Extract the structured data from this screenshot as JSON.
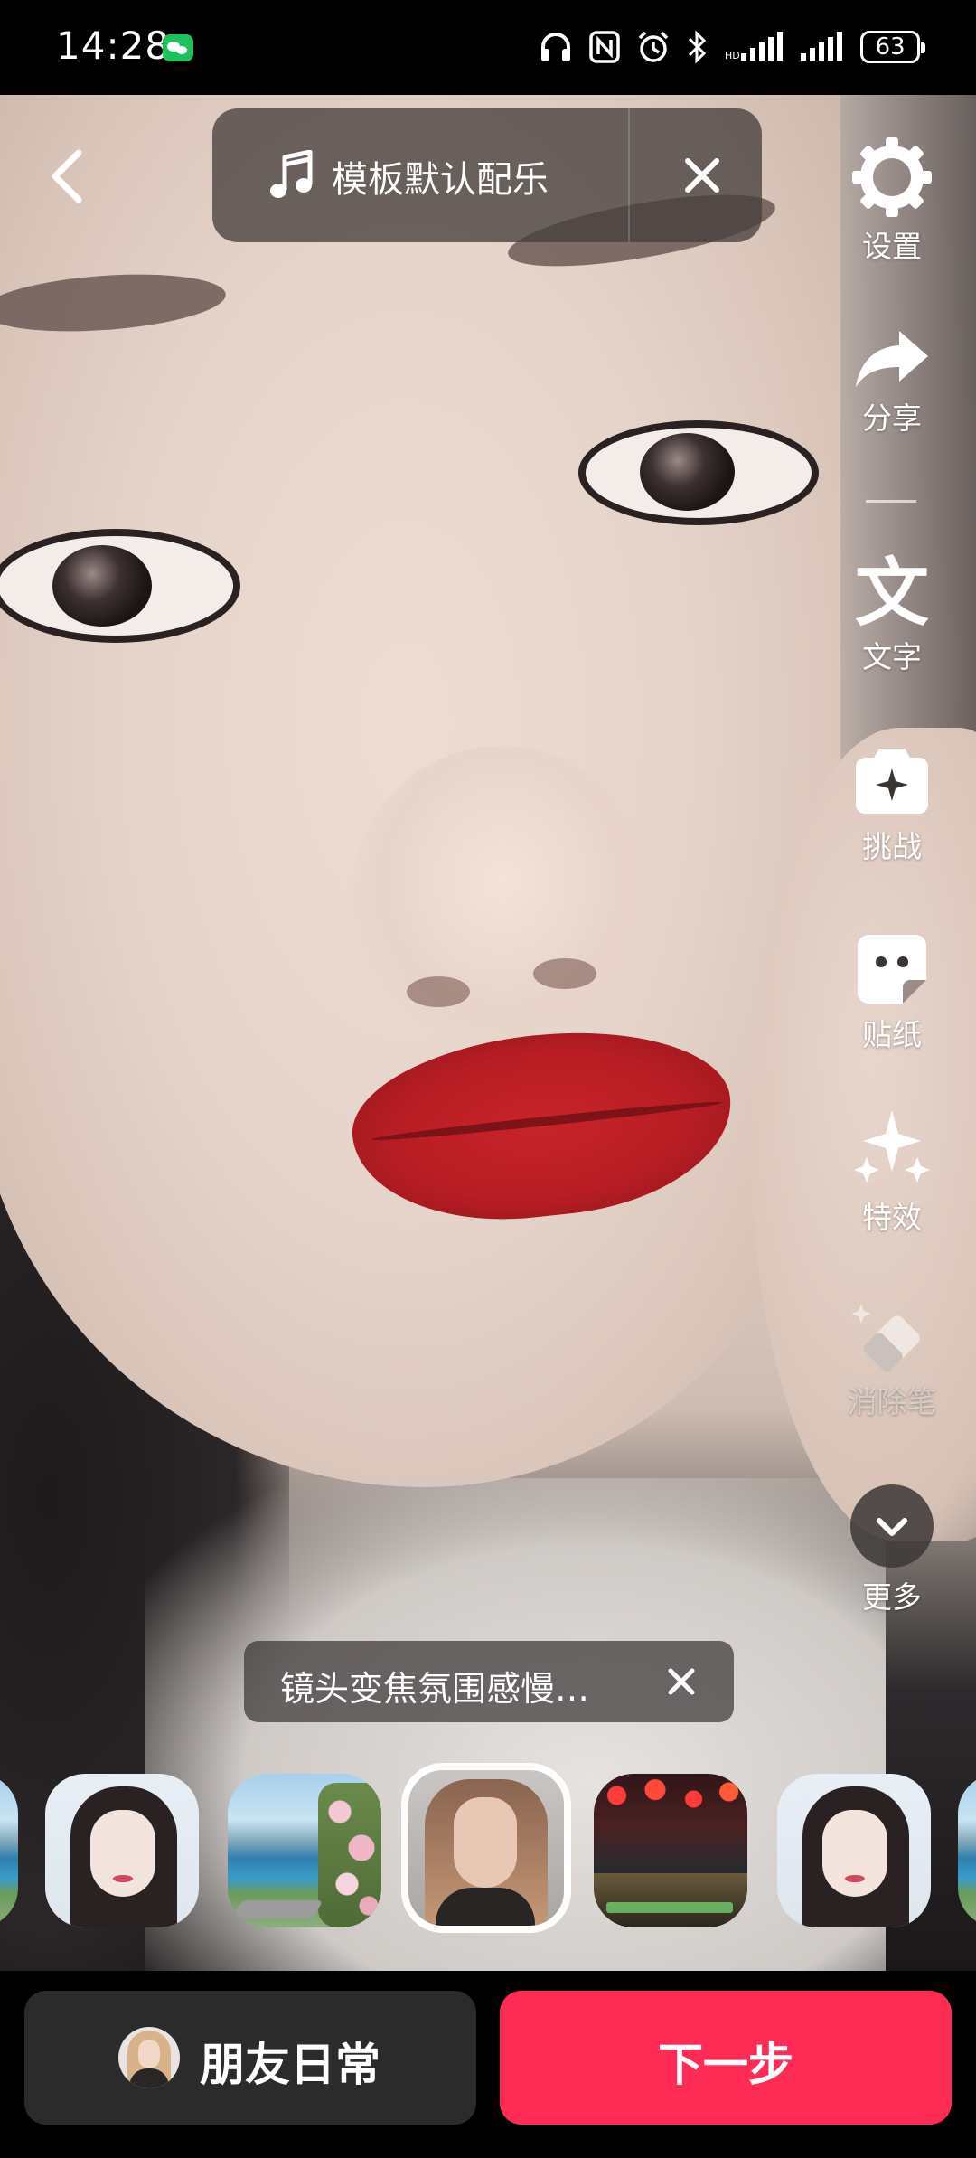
{
  "status_bar": {
    "time": "14:28",
    "battery": "63",
    "icons": [
      "wechat-icon",
      "headphones-icon",
      "nfc-icon",
      "alarm-icon",
      "bluetooth-icon",
      "signal-icon",
      "signal-icon",
      "battery-icon"
    ]
  },
  "top_bar": {
    "back_icon": "chevron-left-icon",
    "music_label": "模板默认配乐",
    "music_icon": "music-note-icon",
    "close_icon": "close-icon"
  },
  "side_tools": {
    "settings": "设置",
    "share": "分享",
    "text": "文字",
    "challenge": "挑战",
    "sticker": "贴纸",
    "effects": "特效",
    "eraser": "消除笔",
    "more": "更多"
  },
  "template_tip": {
    "label": "镜头变焦氛围感慢…"
  },
  "template_strip": {
    "items": [
      "portrait",
      "lake-landscape",
      "selfie",
      "night-street",
      "portrait"
    ],
    "selected_index": 2
  },
  "bottom_bar": {
    "friends_label": "朋友日常",
    "next_label": "下一步"
  },
  "colors": {
    "accent": "#fe2c55",
    "dark_button": "#2b2b2b"
  }
}
